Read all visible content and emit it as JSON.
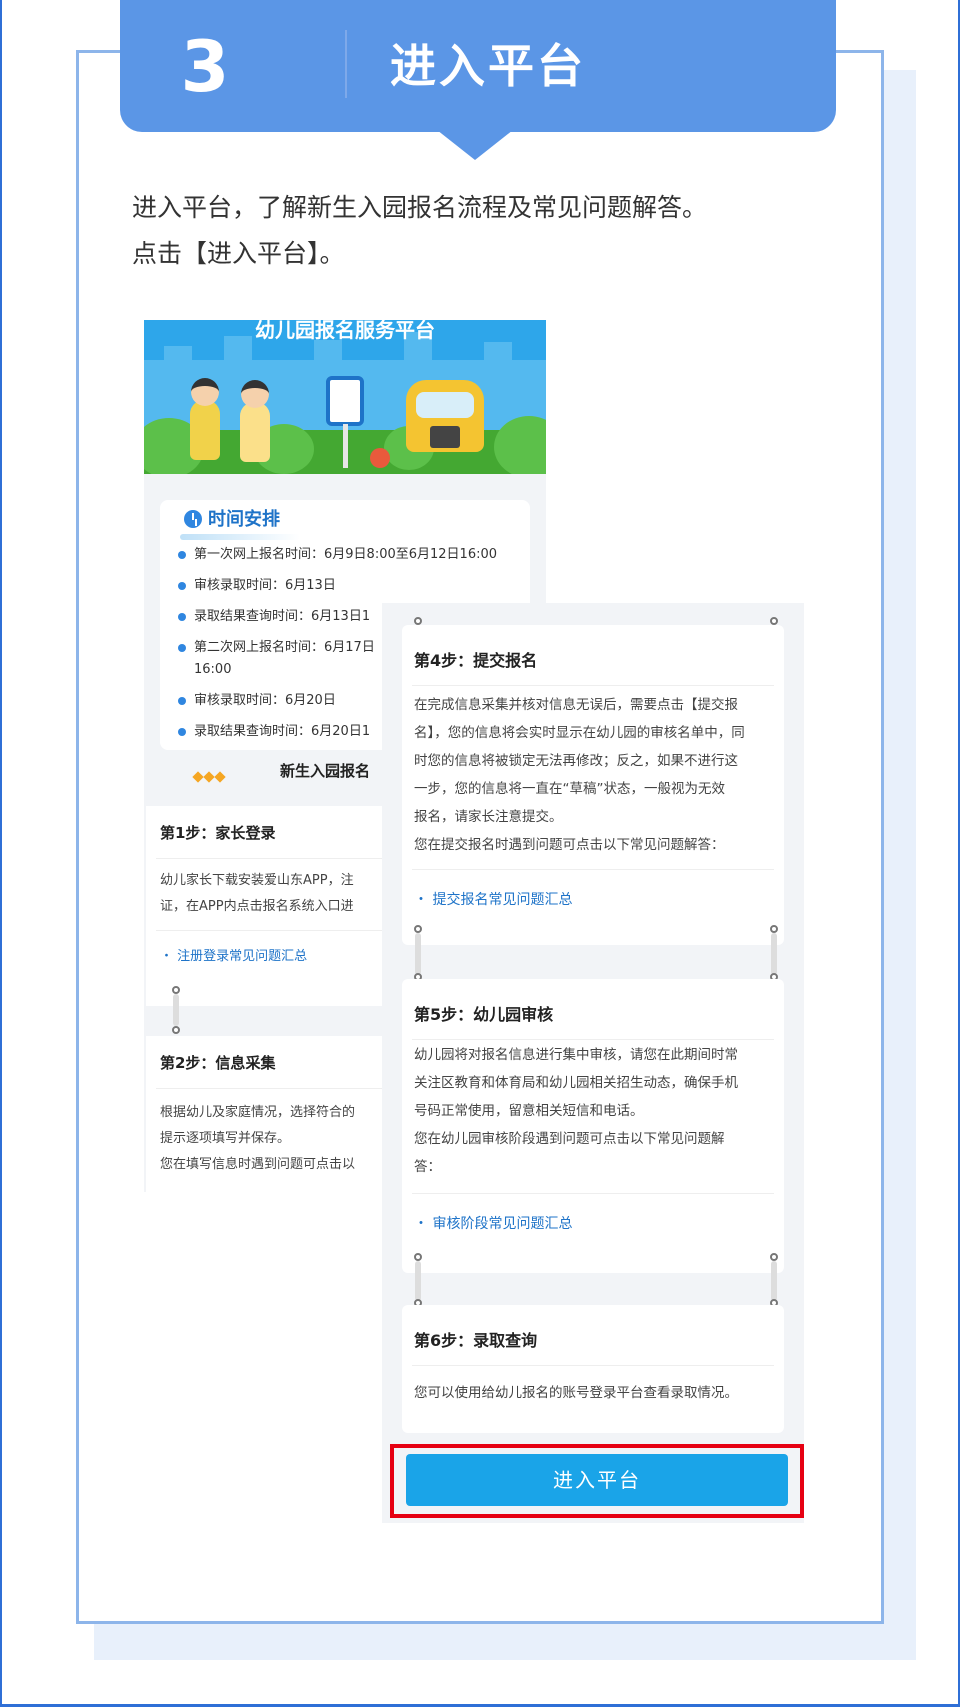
{
  "step": {
    "number": "3",
    "title": "进入平台"
  },
  "description": {
    "line1": "进入平台，了解新生入园报名流程及常见问题解答。",
    "line2": "点击【进入平台】。"
  },
  "platform_screen_left": {
    "hero_title": "幼儿园报名服务平台",
    "schedule": {
      "title": "时间安排",
      "items": [
        "第一次网上报名时间：6月9日8:00至6月12日16:00",
        "审核录取时间：6月13日",
        "录取结果查询时间：6月13日1",
        "第二次网上报名时间：6月17日",
        "16:00",
        "审核录取时间：6月20日",
        "录取结果查询时间：6月20日1"
      ]
    },
    "flow_title": "新生入园报名",
    "step1": {
      "title": "第1步：家长登录",
      "text_lines": [
        "幼儿家长下载安装爱山东APP，注",
        "证，在APP内点击报名系统入口进"
      ],
      "link": "・ 注册登录常见问题汇总"
    },
    "step2": {
      "title": "第2步：信息采集",
      "text_lines": [
        "根据幼儿及家庭情况，选择符合的",
        "提示逐项填写并保存。",
        "您在填写信息时遇到问题可点击以"
      ]
    }
  },
  "platform_screen_right": {
    "step4": {
      "title": "第4步：提交报名",
      "text_lines": [
        "在完成信息采集并核对信息无误后，需要点击【提交报",
        "名】，您的信息将会实时显示在幼儿园的审核名单中，同",
        "时您的信息将被锁定无法再修改；反之，如果不进行这",
        "一步，您的信息将一直在“草稿”状态，一般视为无效",
        "报名，请家长注意提交。",
        "您在提交报名时遇到问题可点击以下常见问题解答："
      ],
      "link": "・ 提交报名常见问题汇总"
    },
    "step5": {
      "title": "第5步：幼儿园审核",
      "text_lines": [
        "幼儿园将对报名信息进行集中审核，请您在此期间时常",
        "关注区教育和体育局和幼儿园相关招生动态，确保手机",
        "号码正常使用，留意相关短信和电话。",
        "您在幼儿园审核阶段遇到问题可点击以下常见问题解",
        "答："
      ],
      "link": "・ 审核阶段常见问题汇总"
    },
    "step6": {
      "title": "第6步：录取查询",
      "text_lines": [
        "您可以使用给幼儿报名的账号登录平台查看录取情况。"
      ]
    },
    "enter_button": "进入平台"
  },
  "colors": {
    "banner": "#5b96e6",
    "card_border": "#8db5ea",
    "button": "#1aa4e8",
    "highlight": "#e60012",
    "link": "#1e73c8"
  }
}
